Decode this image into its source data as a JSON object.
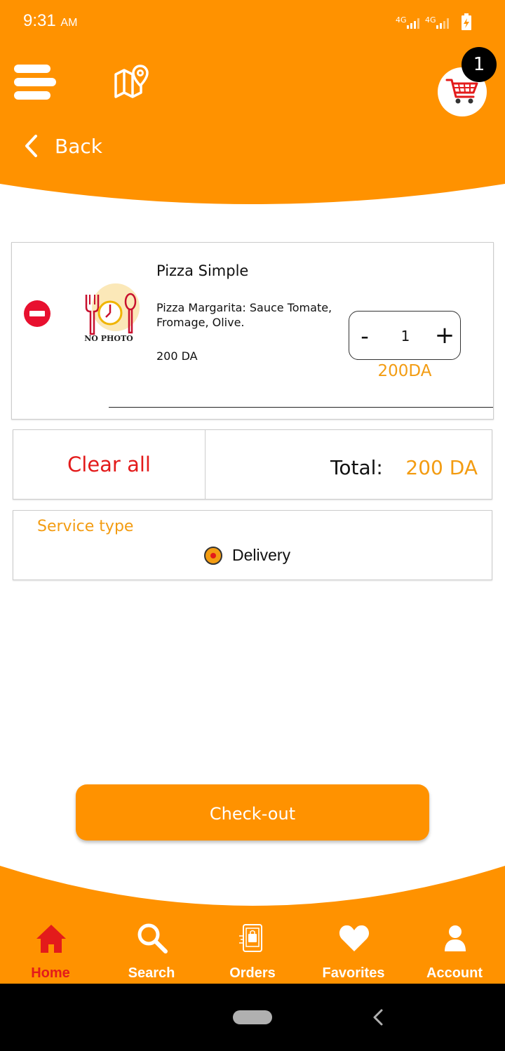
{
  "status_bar": {
    "time": "9:31",
    "ampm": "AM",
    "network": "4G"
  },
  "header": {
    "cart_count": "1",
    "back_label": "Back"
  },
  "cart_item": {
    "name": "Pizza Simple",
    "description": "Pizza Margarita: Sauce Tomate, Fromage, Olive.",
    "unit_price": "200 DA",
    "photo_placeholder": "NO PHOTO",
    "quantity": "1",
    "minus_label": "-",
    "plus_label": "+",
    "line_total": "200DA"
  },
  "totals": {
    "clear_label": "Clear all",
    "total_label": "Total:",
    "total_value": "200 DA"
  },
  "service": {
    "title": "Service type",
    "options": [
      {
        "label": "Delivery",
        "selected": true
      }
    ]
  },
  "checkout_label": "Check-out",
  "bottom_nav": [
    {
      "label": "Home",
      "icon": "home-icon",
      "active": true
    },
    {
      "label": "Search",
      "icon": "search-icon",
      "active": false
    },
    {
      "label": "Orders",
      "icon": "orders-icon",
      "active": false
    },
    {
      "label": "Favorites",
      "icon": "heart-icon",
      "active": false
    },
    {
      "label": "Account",
      "icon": "account-icon",
      "active": false
    }
  ],
  "colors": {
    "brand_orange": "#ff9200",
    "price_orange": "#f39c12",
    "danger_red": "#e31b1b",
    "badge_black": "#000000"
  }
}
